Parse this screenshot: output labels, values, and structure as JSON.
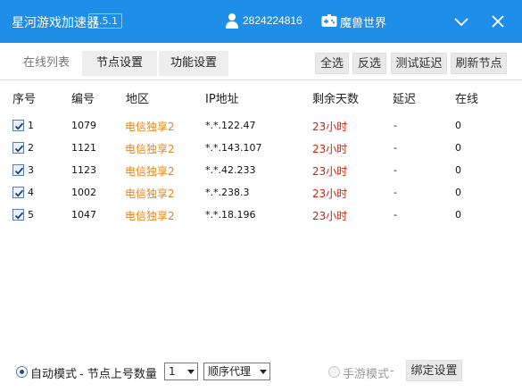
{
  "titlebar": {
    "app_title": "星河游戏加速器",
    "version": "1.5.1",
    "user_id": "2824224816",
    "game_name": "魔兽世界"
  },
  "tabs": [
    {
      "label": "在线列表",
      "active": false
    },
    {
      "label": "节点设置",
      "active": true
    },
    {
      "label": "功能设置",
      "active": true
    }
  ],
  "toolbar": {
    "select_all": "全选",
    "invert": "反选",
    "test_latency": "测试延迟",
    "refresh_nodes": "刷新节点"
  },
  "table": {
    "headers": [
      "序号",
      "编号",
      "地区",
      "IP地址",
      "剩余天数",
      "延迟",
      "在线"
    ],
    "rows": [
      {
        "index": "1",
        "id": "1079",
        "region": "电信独享2",
        "ip": "*.*.122.47",
        "days": "23小时",
        "latency": "-",
        "online": "0",
        "checked": true
      },
      {
        "index": "2",
        "id": "1121",
        "region": "电信独享2",
        "ip": "*.*.143.107",
        "days": "23小时",
        "latency": "-",
        "online": "0",
        "checked": true
      },
      {
        "index": "3",
        "id": "1123",
        "region": "电信独享2",
        "ip": "*.*.42.233",
        "days": "23小时",
        "latency": "-",
        "online": "0",
        "checked": true
      },
      {
        "index": "4",
        "id": "1002",
        "region": "电信独享2",
        "ip": "*.*.238.3",
        "days": "23小时",
        "latency": "-",
        "online": "0",
        "checked": true
      },
      {
        "index": "5",
        "id": "1047",
        "region": "电信独享2",
        "ip": "*.*.18.196",
        "days": "23小时",
        "latency": "-",
        "online": "0",
        "checked": true
      }
    ]
  },
  "bottom": {
    "auto_mode": "自动模式",
    "node_count_label": "- 节点上号数量",
    "node_count_value": "1",
    "proxy_mode_value": "顺序代理",
    "mobile_mode": "手游模式",
    "mobile_dash": "-",
    "bind_settings": "绑定设置"
  },
  "colors": {
    "titlebar": "#1e8ee8",
    "region": "#e8840c",
    "days": "#d81e06"
  }
}
